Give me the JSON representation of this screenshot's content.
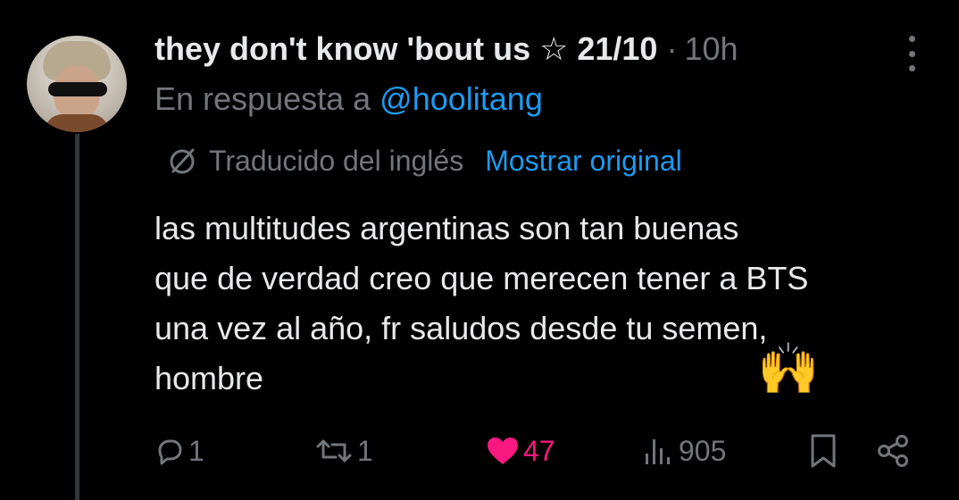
{
  "tweet": {
    "author_name": "they don't know 'bout us ☆ 21/10",
    "separator": "·",
    "time": "10h",
    "reply_prefix": "En respuesta a",
    "reply_handle": "@hoolitang",
    "translated_label": "Traducido del inglés",
    "show_original_label": "Mostrar original",
    "text_lines": [
      "las multitudes argentinas son tan buenas",
      "que de verdad creo que merecen tener a BTS",
      "una vez al año, fr saludos desde tu semen,",
      "hombre"
    ],
    "emoji": "🙌"
  },
  "actions": {
    "reply": {
      "icon": "reply-icon",
      "count": "1"
    },
    "retweet": {
      "icon": "retweet-icon",
      "count": "1"
    },
    "like": {
      "icon": "heart-icon",
      "count": "47",
      "color": "#f91880"
    },
    "views": {
      "icon": "views-icon",
      "count": "905"
    },
    "bookmark": {
      "icon": "bookmark-icon"
    },
    "share": {
      "icon": "share-icon"
    }
  },
  "colors": {
    "background": "#000000",
    "text": "#e7e9ea",
    "muted": "#71767b",
    "link": "#1d9bf0",
    "like": "#f91880"
  }
}
